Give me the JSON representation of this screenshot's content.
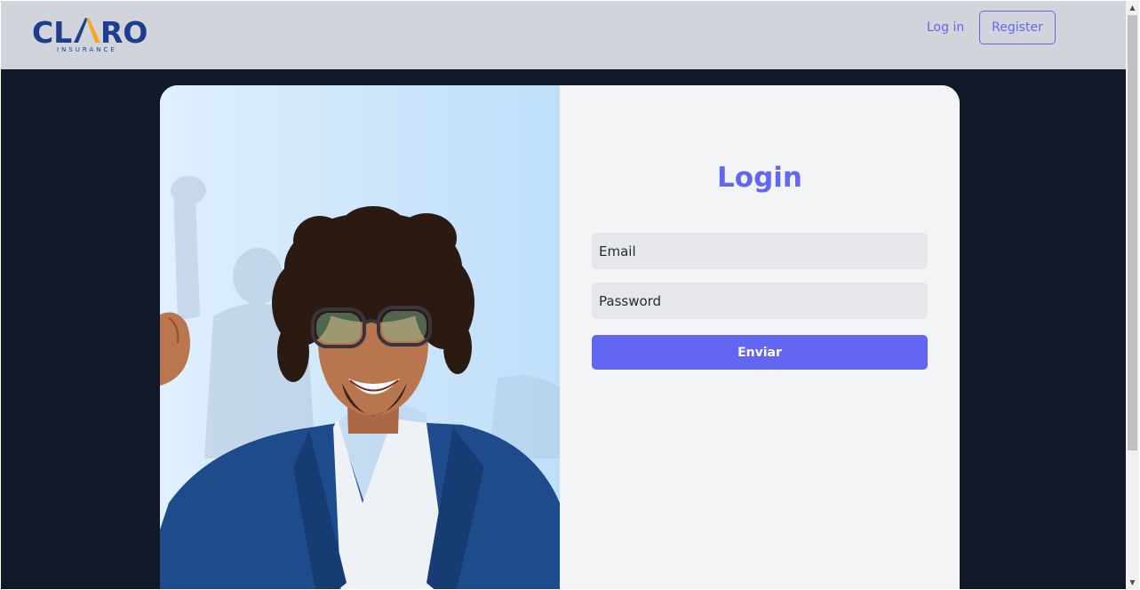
{
  "navbar": {
    "logo": {
      "word": "CLARO",
      "subtitle": "INSURANCE"
    },
    "login_label": "Log in",
    "register_label": "Register"
  },
  "hero": {
    "image": "smiling-man-with-glasses-photo"
  },
  "form": {
    "title": "Login",
    "email_placeholder": "Email",
    "password_placeholder": "Password",
    "submit_label": "Enviar"
  },
  "colors": {
    "accent": "#6366f1",
    "page_background": "#111827",
    "navbar_background": "#d1d5db",
    "logo_blue": "#1d3d8f",
    "logo_orange": "#f5a623"
  },
  "icons": {
    "scroll_up": "scroll-up-arrow-icon",
    "scroll_down": "scroll-down-arrow-icon"
  }
}
